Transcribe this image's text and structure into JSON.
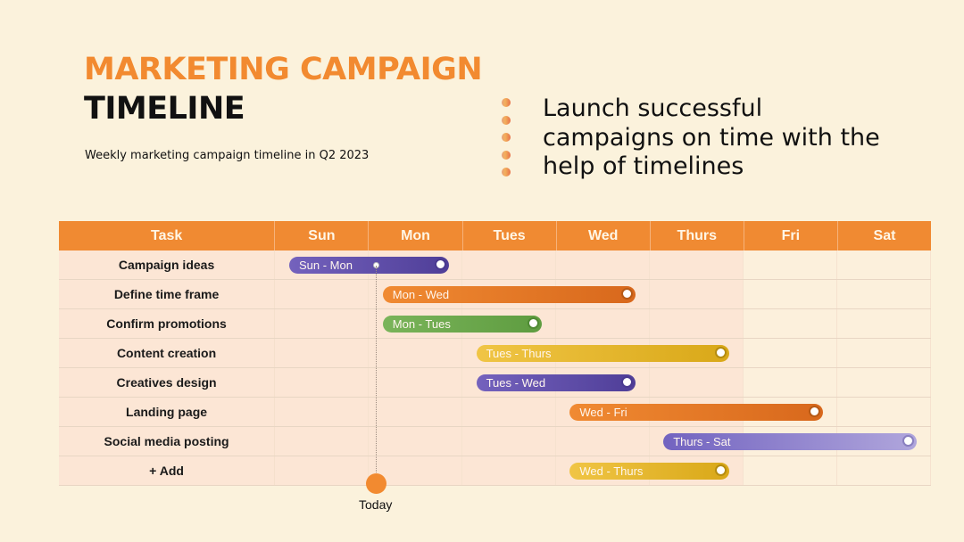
{
  "header": {
    "title_line1": "MARKETING CAMPAIGN",
    "title_line2": "TIMELINE",
    "subtitle": "Weekly marketing campaign timeline in Q2 2023"
  },
  "tagline": "Launch successful campaigns on time with the help of timelines",
  "colors": {
    "accent": "#f28a30",
    "background": "#fbf2dc",
    "purple": "#6a54b0",
    "orange": "#e9782a",
    "green": "#6aa84f",
    "yellow": "#e5b52a",
    "lavender": "#9b8ed8"
  },
  "chart_data": {
    "type": "gantt",
    "title": "Marketing Campaign Timeline",
    "columns": [
      "Task",
      "Sun",
      "Mon",
      "Tues",
      "Wed",
      "Thurs",
      "Fri",
      "Sat"
    ],
    "tasks": [
      {
        "name": "Campaign ideas",
        "label": "Sun - Mon",
        "start": "Sun",
        "end": "Mon",
        "start_index": 0,
        "end_index": 1,
        "color": "purple"
      },
      {
        "name": "Define time frame",
        "label": "Mon - Wed",
        "start": "Mon",
        "end": "Wed",
        "start_index": 1,
        "end_index": 3,
        "color": "orange"
      },
      {
        "name": "Confirm promotions",
        "label": "Mon - Tues",
        "start": "Mon",
        "end": "Tues",
        "start_index": 1,
        "end_index": 2,
        "color": "green"
      },
      {
        "name": "Content creation",
        "label": "Tues - Thurs",
        "start": "Tues",
        "end": "Thurs",
        "start_index": 2,
        "end_index": 4,
        "color": "yellow"
      },
      {
        "name": "Creatives design",
        "label": "Tues - Wed",
        "start": "Tues",
        "end": "Wed",
        "start_index": 2,
        "end_index": 3,
        "color": "purple"
      },
      {
        "name": "Landing page",
        "label": "Wed - Fri",
        "start": "Wed",
        "end": "Fri",
        "start_index": 3,
        "end_index": 5,
        "color": "orange"
      },
      {
        "name": "Social media posting",
        "label": "Thurs - Sat",
        "start": "Thurs",
        "end": "Sat",
        "start_index": 4,
        "end_index": 6,
        "color": "lavender"
      },
      {
        "name": "+ Add",
        "label": "Wed - Thurs",
        "start": "Wed",
        "end": "Thurs",
        "start_index": 3,
        "end_index": 4,
        "color": "yellow"
      }
    ],
    "today_marker": {
      "label": "Today",
      "day": "Mon",
      "position_fraction_of_day": 0.05
    },
    "shaded_days": [
      "Sun",
      "Mon",
      "Tues",
      "Wed",
      "Thurs"
    ]
  }
}
